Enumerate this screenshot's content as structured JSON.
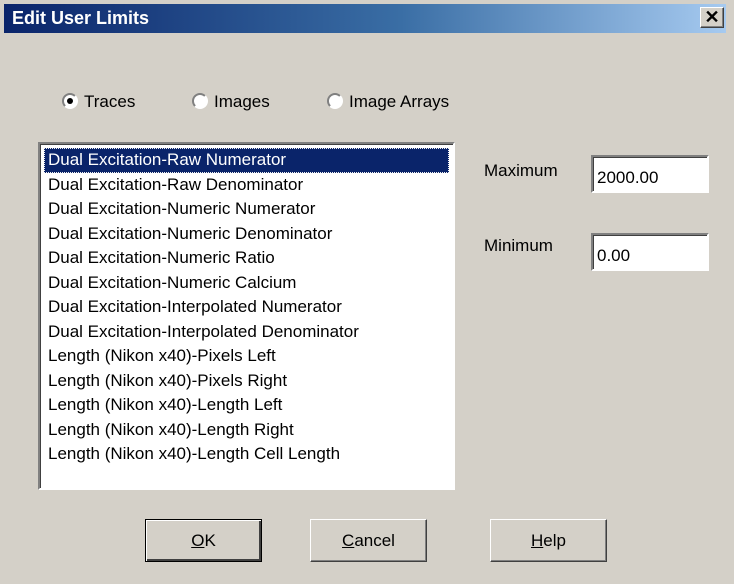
{
  "window": {
    "title": "Edit User Limits",
    "close_glyph": "✕"
  },
  "radios": [
    {
      "label": "Traces",
      "selected": true
    },
    {
      "label": "Images",
      "selected": false
    },
    {
      "label": "Image Arrays",
      "selected": false
    }
  ],
  "list": {
    "items": [
      "Dual Excitation-Raw Numerator",
      "Dual Excitation-Raw Denominator",
      "Dual Excitation-Numeric Numerator",
      "Dual Excitation-Numeric Denominator",
      "Dual Excitation-Numeric Ratio",
      "Dual Excitation-Numeric Calcium",
      "Dual Excitation-Interpolated Numerator",
      "Dual Excitation-Interpolated Denominator",
      "Length (Nikon x40)-Pixels Left",
      "Length (Nikon x40)-Pixels Right",
      "Length (Nikon x40)-Length Left",
      "Length (Nikon x40)-Length Right",
      "Length (Nikon x40)-Length Cell Length"
    ],
    "selected_index": 0
  },
  "limits": {
    "maximum_label": "Maximum",
    "maximum_value": "2000.00",
    "minimum_label": "Minimum",
    "minimum_value": "0.00"
  },
  "buttons": {
    "ok": {
      "mnemonic": "O",
      "rest": "K"
    },
    "cancel": {
      "mnemonic": "C",
      "rest": "ancel"
    },
    "help": {
      "mnemonic": "H",
      "rest": "elp"
    }
  }
}
